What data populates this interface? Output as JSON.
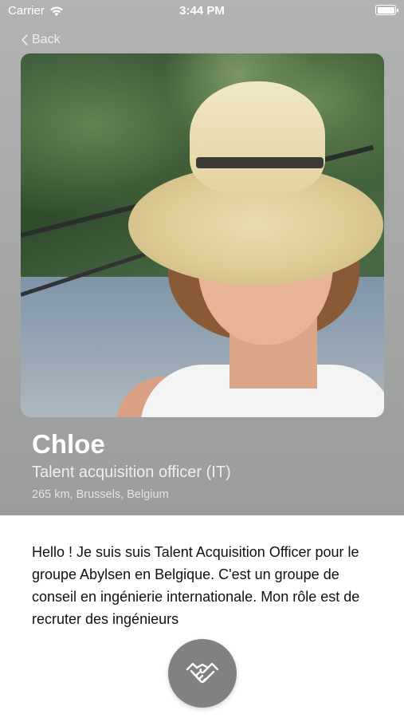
{
  "status_bar": {
    "carrier": "Carrier",
    "time": "3:44 PM"
  },
  "nav": {
    "back_label": "Back"
  },
  "profile": {
    "name": "Chloe",
    "title": "Talent acquisition officer (IT)",
    "location": "265 km, Brussels, Belgium",
    "bio": "Hello ! Je suis suis Talent Acquisition Officer pour le groupe Abylsen en Belgique. C'est un groupe de conseil en ingénierie internationale. Mon rôle est de recruter des ingénieurs"
  },
  "actions": {
    "connect_icon": "handshake-icon"
  },
  "colors": {
    "header_bg": "#a8a9a9",
    "button_bg": "#808182"
  }
}
